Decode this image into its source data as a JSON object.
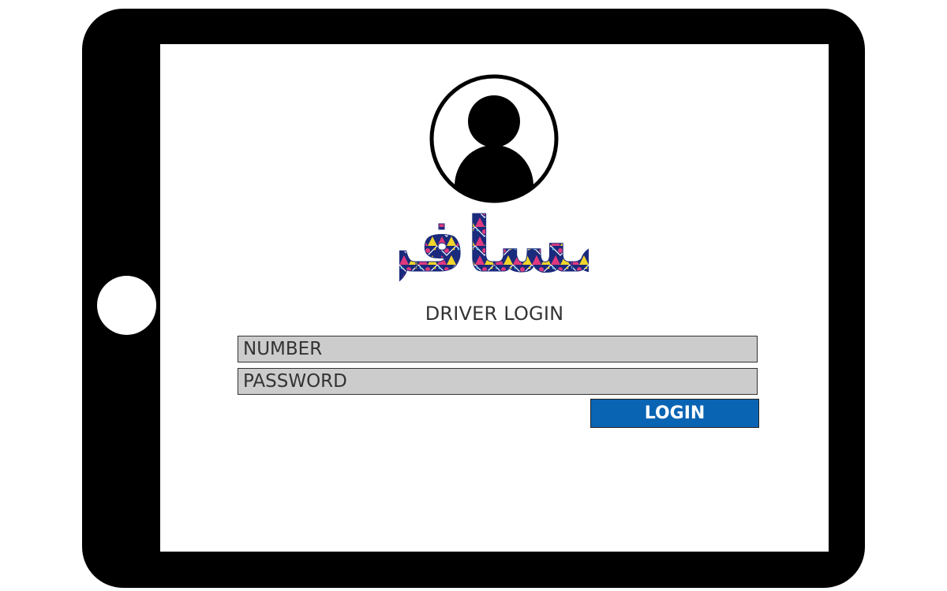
{
  "logo": {
    "text": "مسافر"
  },
  "login": {
    "title": "DRIVER LOGIN",
    "number_placeholder": "NUMBER",
    "password_placeholder": "PASSWORD",
    "button_label": "LOGIN"
  },
  "colors": {
    "device_frame": "#000000",
    "input_background": "#cccccc",
    "button_background": "#0a64b4",
    "button_text": "#ffffff",
    "logo_pink": "#e0397f",
    "logo_navy": "#1a2a7c",
    "logo_yellow": "#f2d52a"
  },
  "icons": [
    "user-avatar-icon",
    "home-button"
  ]
}
